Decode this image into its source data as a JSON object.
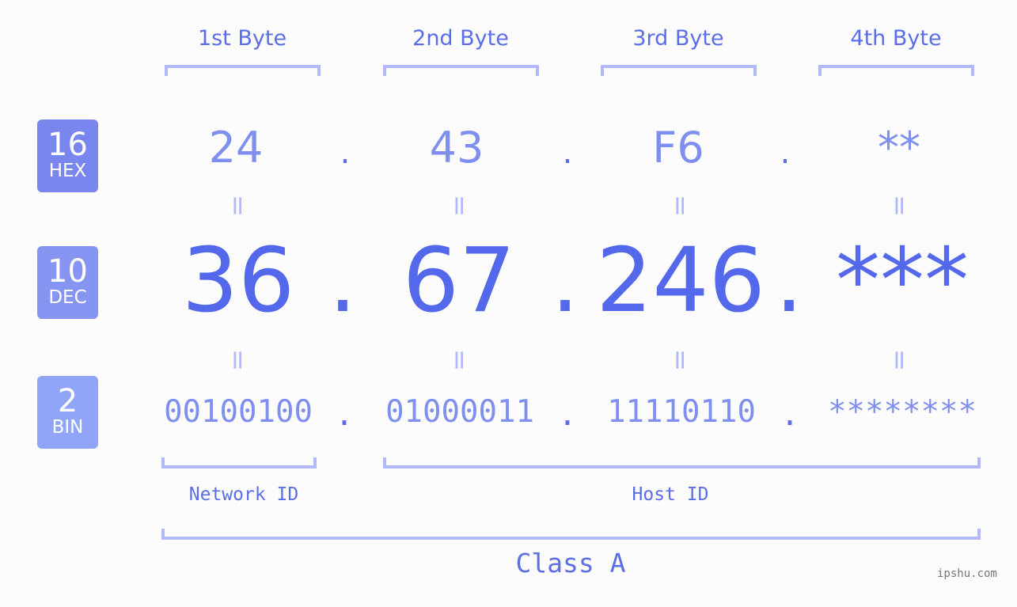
{
  "byte_headers": [
    "1st Byte",
    "2nd Byte",
    "3rd Byte",
    "4th Byte"
  ],
  "badges": {
    "hex": {
      "num": "16",
      "label": "HEX",
      "color": "#7886ee"
    },
    "dec": {
      "num": "10",
      "label": "DEC",
      "color": "#8695f1"
    },
    "bin": {
      "num": "2",
      "label": "BIN",
      "color": "#91a5f8"
    }
  },
  "hex_values": [
    "24",
    "43",
    "F6",
    "**"
  ],
  "dec_values": [
    "36",
    "67",
    "246",
    "***"
  ],
  "bin_values": [
    "00100100",
    "01000011",
    "11110110",
    "********"
  ],
  "separator": ".",
  "equals": "=",
  "network_id_label": "Network ID",
  "host_id_label": "Host ID",
  "class_label": "Class A",
  "watermark": "ipshu.com",
  "colors": {
    "primary": "#5468ec",
    "light": "#7f8ff0",
    "bracket": "#b1baf7"
  }
}
